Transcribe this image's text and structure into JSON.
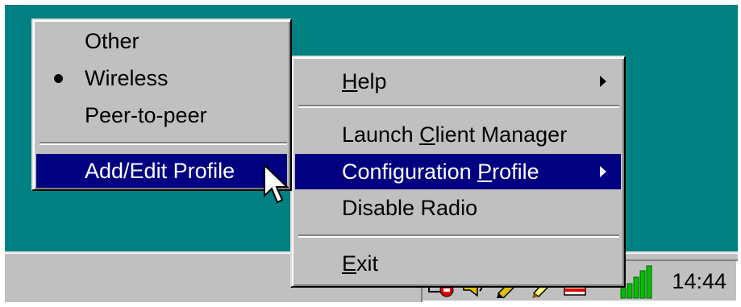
{
  "taskbar": {
    "clock": "14:44",
    "tray_icons": [
      "network-error-icon",
      "speaker-icon",
      "pen-icon",
      "pencil-icon",
      "folder-icon",
      "signal-strength-icon"
    ],
    "signal_color": "#00c000"
  },
  "main_menu": {
    "help": {
      "label": "Help",
      "mnemonic": "H",
      "has_submenu": true
    },
    "launch_client_manager": {
      "label": "Launch Client Manager",
      "mnemonic": "C"
    },
    "configuration_profile": {
      "label": "Configuration Profile",
      "mnemonic": "P",
      "has_submenu": true,
      "highlighted": true
    },
    "disable_radio": {
      "label": "Disable Radio"
    },
    "exit": {
      "label": "Exit",
      "mnemonic": "E"
    }
  },
  "profile_submenu": {
    "other": {
      "label": "Other"
    },
    "wireless": {
      "label": "Wireless",
      "checked": true
    },
    "peer_to_peer": {
      "label": "Peer-to-peer"
    },
    "add_edit_profile": {
      "label": "Add/Edit Profile",
      "highlighted": true
    }
  },
  "colors": {
    "desktop": "#008080",
    "menu_face": "#c0c0c0",
    "highlight": "#000080",
    "highlight_text": "#ffffff"
  }
}
